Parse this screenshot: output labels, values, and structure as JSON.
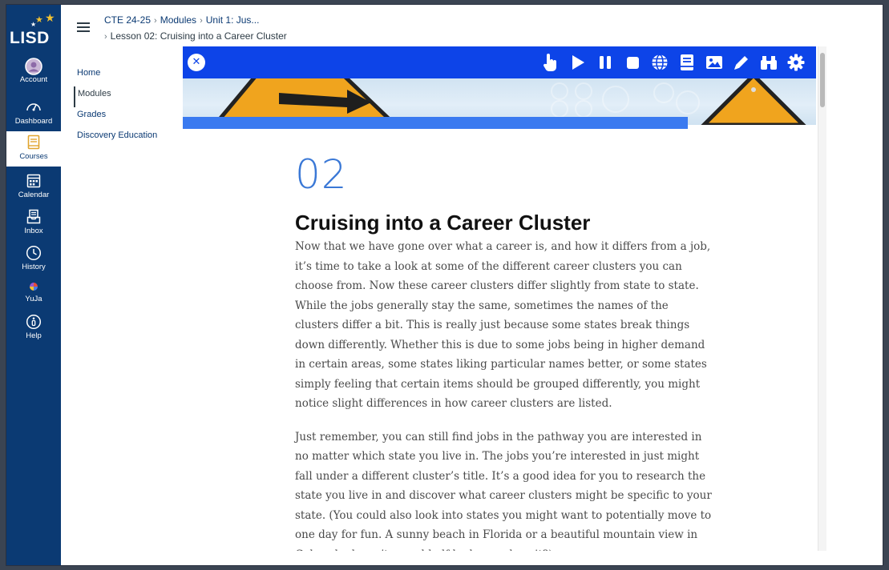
{
  "global_nav": {
    "logo_text": "LISD",
    "items": [
      {
        "label": "Account",
        "icon": "account-icon"
      },
      {
        "label": "Dashboard",
        "icon": "dashboard-icon"
      },
      {
        "label": "Courses",
        "icon": "courses-icon",
        "active": true
      },
      {
        "label": "Calendar",
        "icon": "calendar-icon"
      },
      {
        "label": "Inbox",
        "icon": "inbox-icon"
      },
      {
        "label": "History",
        "icon": "history-icon"
      },
      {
        "label": "YuJa",
        "icon": "yuja-icon"
      },
      {
        "label": "Help",
        "icon": "help-icon"
      }
    ]
  },
  "breadcrumb": {
    "course": "CTE 24-25",
    "modules": "Modules",
    "unit": "Unit 1: Jus...",
    "lesson": "Lesson 02: Cruising into a Career Cluster"
  },
  "course_nav": {
    "items": [
      {
        "label": "Home"
      },
      {
        "label": "Modules",
        "active": true
      },
      {
        "label": "Grades"
      },
      {
        "label": "Discovery Education"
      }
    ]
  },
  "toolbar": {
    "icons": [
      "close-icon",
      "pointer-icon",
      "play-icon",
      "pause-icon",
      "stop-icon",
      "globe-icon",
      "book-icon",
      "image-icon",
      "pencil-icon",
      "binoculars-icon",
      "gear-icon"
    ],
    "color": "#0d44e8"
  },
  "article": {
    "number": "02",
    "title": "Cruising into a Career Cluster",
    "paragraph1": "Now that we have gone over what a career is, and how it differs from a job, it’s time to take a look at some of the different career clusters you can choose from. Now these career clusters differ slightly from state to state. While the jobs generally stay the same, sometimes the names of the clusters differ a bit. This is really just because some states break things down differently. Whether this is due to some jobs being in higher demand in certain areas, some states liking particular names better, or some states simply feeling that certain items should be grouped differently, you might notice slight differences in how career clusters are listed.",
    "paragraph2": "Just remember, you can still find jobs in the pathway you are interested in no matter which state you live in. The jobs you’re interested in just might fall under a different cluster’s title. It’s a good idea for you to research the state you live in and discover what career clusters might be specific to your state. (You could also look into states you might want to potentially move to one day for fun. A sunny beach in Florida or a beautiful mountain view in Colorado doesn’t sound half bad, now does it?)"
  },
  "colors": {
    "nav_bg": "#0b3a73",
    "accent_number": "#3a78d6",
    "bluebar": "#3a7af0"
  }
}
